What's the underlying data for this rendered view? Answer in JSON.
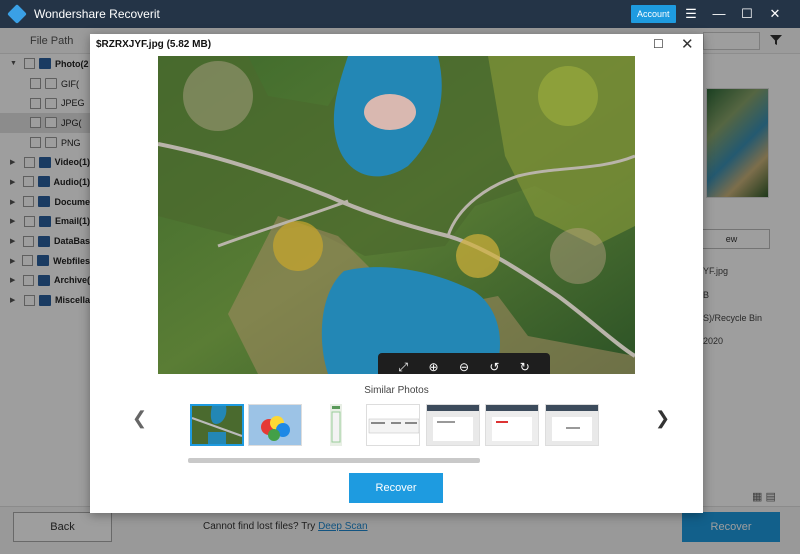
{
  "app": {
    "title": "Wondershare Recoverit",
    "account_label": "Account",
    "menu_icon": "hamburger-icon",
    "minimize_icon": "minimize-icon",
    "maximize_icon": "maximize-icon",
    "close_icon": "close-icon"
  },
  "toolbar": {
    "file_path_label": "File Path",
    "filter_icon": "filter-icon"
  },
  "tree": [
    {
      "label": "Photo(2",
      "expanded": true
    },
    {
      "label": "GIF(",
      "sub": true
    },
    {
      "label": "JPEG",
      "sub": true
    },
    {
      "label": "JPG(",
      "sub": true,
      "selected": true
    },
    {
      "label": "PNG",
      "sub": true
    },
    {
      "label": "Video(1)"
    },
    {
      "label": "Audio(1)"
    },
    {
      "label": "Docume"
    },
    {
      "label": "Email(1)"
    },
    {
      "label": "DataBas"
    },
    {
      "label": "Webfiles"
    },
    {
      "label": "Archive("
    },
    {
      "label": "Miscella"
    }
  ],
  "right_panel": {
    "preview_button": "ew",
    "meta_name": "YF.jpg",
    "meta_size": "B",
    "meta_path": "S)/Recycle Bin",
    "meta_date": "2020"
  },
  "footer": {
    "back_label": "Back",
    "cannot_find_text": "Cannot find lost files? Try",
    "deep_scan_label": "Deep Scan",
    "recover_label": "Recover"
  },
  "modal": {
    "title": "$RZRXJYF.jpg (5.82 MB)",
    "similar_label": "Similar Photos",
    "recover_label": "Recover",
    "zoom_controls": [
      "fit-screen-icon",
      "zoom-in-icon",
      "zoom-out-icon",
      "rotate-left-icon",
      "rotate-right-icon"
    ]
  },
  "colors": {
    "accent": "#1e9be0",
    "titlebar": "#243447"
  }
}
